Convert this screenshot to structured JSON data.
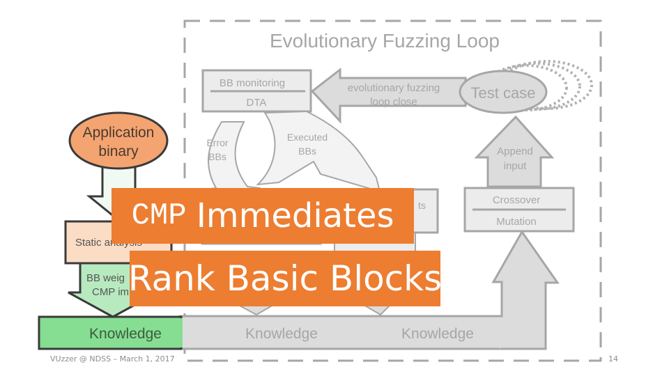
{
  "slide": {
    "title": "Evolutionary Fuzzing Loop",
    "footer_left": "VUzzer @ NDSS – March 1, 2017",
    "page_number": "14"
  },
  "diagram": {
    "bb_box": {
      "top": "BB monitoring",
      "bottom": "DTA"
    },
    "loop_arrow": {
      "line1": "evolutionary fuzzing",
      "line2": "loop close"
    },
    "test_case": "Test case",
    "app_binary": {
      "line1": "Application",
      "line2": "binary"
    },
    "error_bbs": {
      "line1": "Error",
      "line2": "BBs"
    },
    "executed_bbs": {
      "line1": "Executed",
      "line2": "BBs"
    },
    "append_input": {
      "line1": "Append",
      "line2": "input"
    },
    "crossover_box": {
      "top": "Crossover",
      "bottom": "Mutation"
    },
    "hidden_box_label": "ts",
    "static_analysis": "Static analysis",
    "bb_weights": {
      "line1": "BB weig",
      "line2": "CMP im"
    },
    "knowledge_labels": [
      "Knowledge",
      "Knowledge",
      "Knowledge"
    ]
  },
  "overlays": {
    "cmp_word": "CMP",
    "immediates": "Immediates",
    "rank": "Rank Basic Blocks"
  },
  "colors": {
    "accent": "#ed7d31",
    "app_binary_fill": "#f4a470",
    "static_fill": "#fbdcc4",
    "knowledge_green": "#86de92",
    "weights_green": "#b8eac0",
    "gray_fill": "#dcdcdc",
    "gray_stroke": "#a6a6a6"
  }
}
